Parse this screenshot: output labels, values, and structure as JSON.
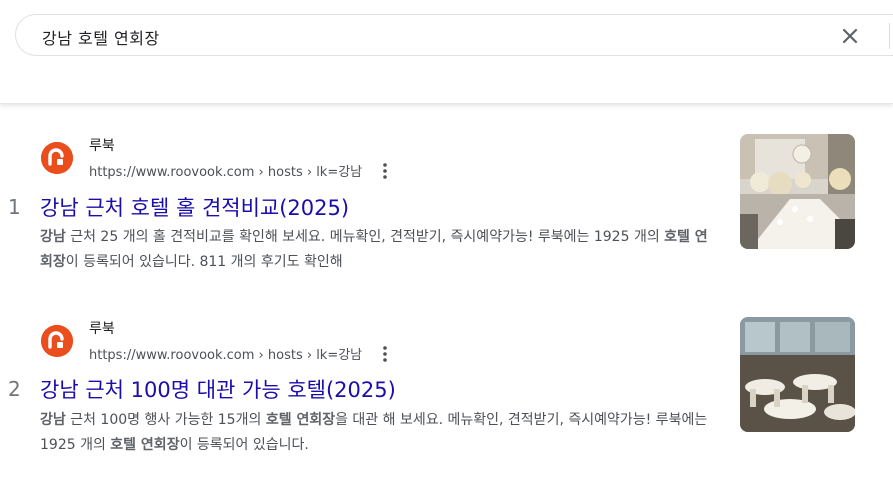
{
  "search": {
    "query": "강남 호텔 연회장"
  },
  "results": [
    {
      "rank": "1",
      "site_name": "루북",
      "url": "https://www.roovook.com › hosts › lk=강남",
      "title": "강남 근처 호텔 홀 견적비교(2025)",
      "snippet_parts": [
        {
          "text": "강남",
          "bold": true
        },
        {
          "text": " 근처 25 개의 홀 견적비교를 확인해 보세요. 메뉴확인, 견적받기, 즉시예약가능! 루북에는 1925 개의 ",
          "bold": false
        },
        {
          "text": "호텔 연회장",
          "bold": true
        },
        {
          "text": "이 등록되어 있습니다. 811 개의 후기도 확인해",
          "bold": false
        }
      ],
      "thumbnail": "banquet-hall-white-decor-photo"
    },
    {
      "rank": "2",
      "site_name": "루북",
      "url": "https://www.roovook.com › hosts › lk=강남",
      "title": "강남 근처 100명 대관 가능 호텔(2025)",
      "snippet_parts": [
        {
          "text": "강남",
          "bold": true
        },
        {
          "text": " 근처 100명 행사 가능한 15개의 ",
          "bold": false
        },
        {
          "text": "호텔 연회장",
          "bold": true
        },
        {
          "text": "을 대관 해 보세요. 메뉴확인, 견적받기, 즉시예약가능! 루북에는 1925 개의 ",
          "bold": false
        },
        {
          "text": "호텔 연회장",
          "bold": true
        },
        {
          "text": "이 등록되어 있습니다.",
          "bold": false
        }
      ],
      "thumbnail": "banquet-hall-round-tables-photo"
    }
  ],
  "colors": {
    "link": "#1a0dab",
    "brand": "#ea4e1d",
    "snippet": "#4d5156"
  }
}
